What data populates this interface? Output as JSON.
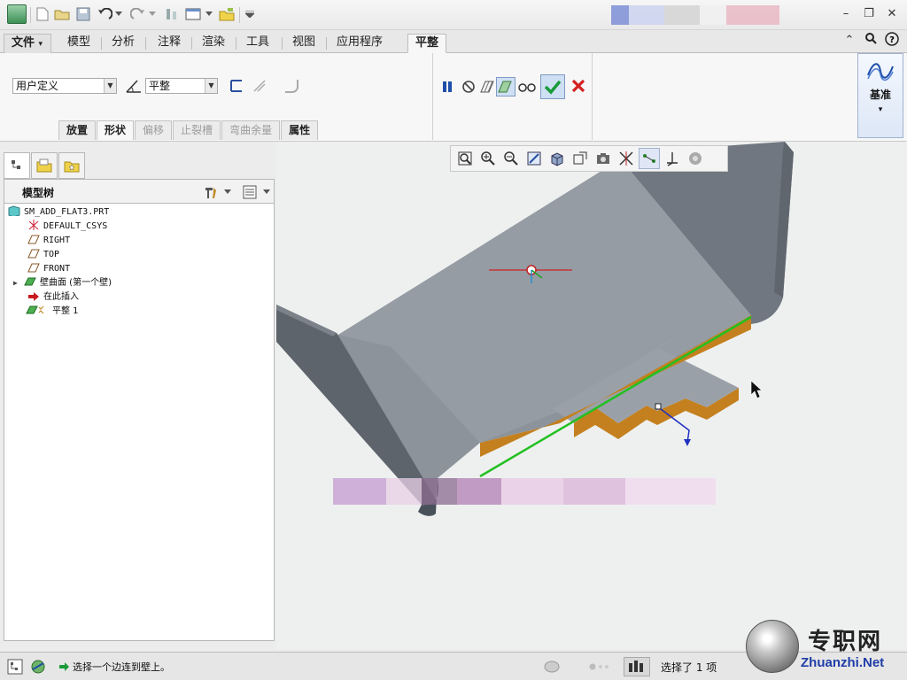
{
  "window": {
    "controls": {
      "minimize": "–",
      "restore": "❐",
      "close": "✕"
    }
  },
  "ribbon": {
    "file_tab": "文件",
    "file_arrow": "▾",
    "tabs": [
      "模型",
      "分析",
      "注释",
      "渲染",
      "工具",
      "视图",
      "应用程序"
    ],
    "active_tab": "平整",
    "right_icons": {
      "collapse": "⌃",
      "search": "⚲",
      "help": "?"
    },
    "options": {
      "type_value": "用户定义",
      "shape_value": "平整"
    },
    "subtabs": [
      {
        "label": "放置",
        "state": "normal"
      },
      {
        "label": "形状",
        "state": "active"
      },
      {
        "label": "偏移",
        "state": "disabled"
      },
      {
        "label": "止裂槽",
        "state": "disabled"
      },
      {
        "label": "弯曲余量",
        "state": "disabled"
      },
      {
        "label": "属性",
        "state": "normal"
      }
    ],
    "datum": {
      "label": "基准",
      "arrow": "▾"
    },
    "accent_colors": {
      "ok": "#1a9a3a",
      "cancel": "#d32020",
      "pause": "#1f4fa8"
    }
  },
  "model_tree": {
    "title": "模型树",
    "items": [
      {
        "label": "SM_ADD_FLAT3.PRT",
        "icon": "part-icon",
        "indent": 0,
        "expander": ""
      },
      {
        "label": "DEFAULT_CSYS",
        "icon": "csys-icon",
        "indent": 1,
        "expander": ""
      },
      {
        "label": "RIGHT",
        "icon": "datum-plane-icon",
        "indent": 1,
        "expander": ""
      },
      {
        "label": "TOP",
        "icon": "datum-plane-icon",
        "indent": 1,
        "expander": ""
      },
      {
        "label": "FRONT",
        "icon": "datum-plane-icon",
        "indent": 1,
        "expander": ""
      },
      {
        "label": "壁曲面 (第一个壁)",
        "icon": "wall-icon",
        "indent": 1,
        "expander": "▶"
      },
      {
        "label": "在此插入",
        "icon": "insert-arrow-icon",
        "indent": 1,
        "expander": ""
      },
      {
        "label": "平整 1",
        "icon": "flat-wall-icon",
        "indent": 1,
        "expander": ""
      }
    ]
  },
  "status": {
    "message": "选择一个边连到壁上。",
    "selection": "选择了 1 项"
  },
  "watermark": {
    "cn": "专职网",
    "en": "Zhuanzhi.Net"
  }
}
